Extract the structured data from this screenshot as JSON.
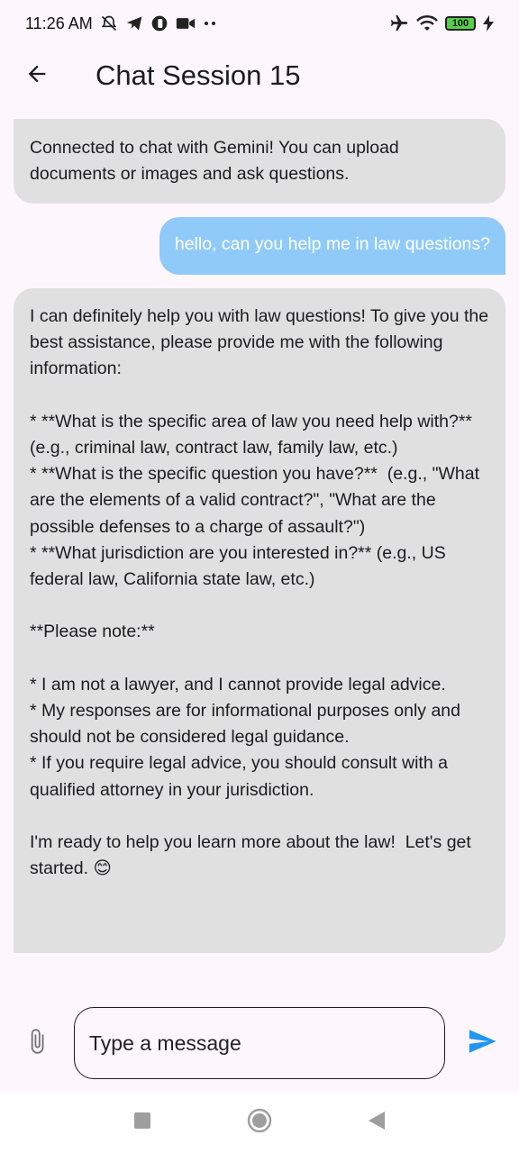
{
  "status_bar": {
    "time": "11:26 AM",
    "battery": "100",
    "icons_left": [
      "notifications-off-icon",
      "telegram-icon",
      "app-icon",
      "video-camera-icon",
      "more-dots-icon"
    ],
    "icons_right": [
      "airplane-mode-icon",
      "wifi-icon",
      "battery-icon",
      "charging-icon"
    ]
  },
  "app_bar": {
    "title": "Chat Session 15",
    "back_icon": "arrow-back-icon"
  },
  "messages": [
    {
      "sender": "bot",
      "text": "Connected to chat with Gemini! You can upload documents or images and ask questions."
    },
    {
      "sender": "user",
      "text": "hello, can you help me in law questions?"
    },
    {
      "sender": "bot",
      "text": "I can definitely help you with law questions! To give you the best assistance, please provide me with the following information:\n\n* **What is the specific area of law you need help with?**  (e.g., criminal law, contract law, family law, etc.)\n* **What is the specific question you have?**  (e.g., \"What are the elements of a valid contract?\", \"What are the possible defenses to a charge of assault?\")\n* **What jurisdiction are you interested in?** (e.g., US federal law, California state law, etc.)\n\n**Please note:**\n\n* I am not a lawyer, and I cannot provide legal advice.\n* My responses are for informational purposes only and should not be considered legal guidance.\n* If you require legal advice, you should consult with a qualified attorney in your jurisdiction.\n\nI'm ready to help you learn more about the law!  Let's get started. 😊\n"
    }
  ],
  "composer": {
    "placeholder": "Type a message",
    "attach_icon": "paperclip-icon",
    "send_icon": "send-icon"
  },
  "colors": {
    "background": "#fdf7fd",
    "bot_bubble": "#e0e0e0",
    "user_bubble": "#90caf9",
    "send_icon": "#2196f3"
  }
}
